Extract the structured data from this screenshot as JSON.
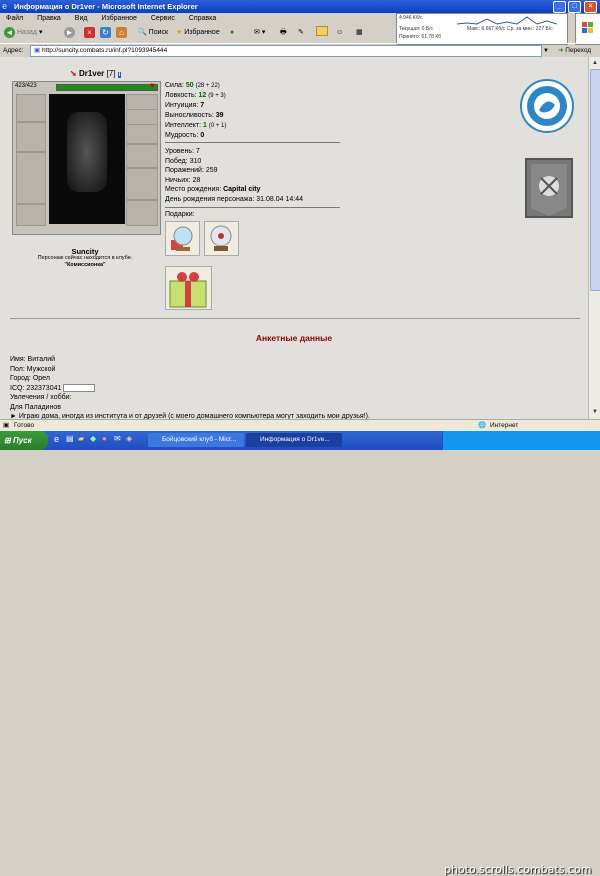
{
  "window": {
    "title": "Информация о Dr1ver - Microsoft Internet Explorer"
  },
  "menu": [
    "Файл",
    "Правка",
    "Вид",
    "Избранное",
    "Сервис",
    "Справка"
  ],
  "toolbar": {
    "back": "Назад",
    "search": "Поиск",
    "favorites": "Избранное"
  },
  "netmon": {
    "l1": "4.946 Кб/с",
    "l2": "Текущая: 0 Б/с",
    "l3": "Принято: 61.78 Кб",
    "m1": "Макс: 6.667 Кб/с",
    "m2": "Ср. за мин.: 227 Б/с"
  },
  "address": {
    "label": "Адрес:",
    "url": "http://suncity.combats.ru/inf.pl?1093945444",
    "go": "Переход"
  },
  "character": {
    "name": "Dr1ver",
    "level": "[7]",
    "badge": "i",
    "hp": "423/423",
    "city": "Suncity",
    "location_note": "Персонаж сейчас находится в клубе.",
    "location_room": "\"Комиссионка\""
  },
  "stats": [
    {
      "label": "Сила:",
      "value": "50",
      "extra": "(28 + 22)"
    },
    {
      "label": "Ловкость:",
      "value": "12",
      "extra": "(9 + 3)"
    },
    {
      "label": "Интуиция:",
      "value": "7",
      "extra": ""
    },
    {
      "label": "Выносливость:",
      "value": "39",
      "extra": ""
    },
    {
      "label": "Интеллект:",
      "value": "1",
      "extra": "(0 + 1)"
    },
    {
      "label": "Мудрость:",
      "value": "0",
      "extra": ""
    }
  ],
  "info": {
    "level_label": "Уровень:",
    "level": "7",
    "wins_label": "Побед:",
    "wins": "310",
    "losses_label": "Поражений:",
    "losses": "259",
    "draws_label": "Ничьих:",
    "draws": "28",
    "birthplace_label": "Место рождения:",
    "birthplace": "Capital city",
    "birthday_label": "День рождения персонажа:",
    "birthday": "31.08.04 14:44"
  },
  "gifts_label": "Подарки:",
  "profile": {
    "section_title": "Анкетные данные",
    "name_label": "Имя:",
    "name": "Виталий",
    "gender_label": "Пол:",
    "gender": "Мужской",
    "city_label": "Город:",
    "city": "Орел",
    "icq_label": "ICQ:",
    "icq": "232373041",
    "hobby_label": "Увлечения / хобби:",
    "hobby": "Для Паладинов",
    "about": "► Играю дома, иногда из института и от друзей (с моего домашнего компьютера могут заходить мои друзья!)."
  },
  "status": {
    "left": "Готово",
    "zone": "Интернет"
  },
  "taskbar": {
    "start": "Пуск",
    "task1": "Бойцовский клуб - Micr...",
    "task2": "Информация о Dr1ve...",
    "watermark": "photo.scrolls.combats.com"
  },
  "colors": {
    "title_bar": "#0a3fc4",
    "section_title": "#8b0000",
    "stat_value": "#006600",
    "hp_bar": "#1c8c1c"
  }
}
